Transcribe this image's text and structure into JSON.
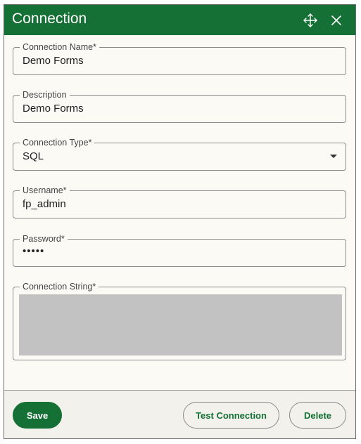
{
  "dialog": {
    "title": "Connection"
  },
  "header_icons": {
    "move": "move-icon",
    "close": "close-icon"
  },
  "fields": {
    "connection_name": {
      "label": "Connection Name*",
      "value": "Demo Forms"
    },
    "description": {
      "label": "Description",
      "value": "Demo Forms"
    },
    "connection_type": {
      "label": "Connection Type*",
      "value": "SQL"
    },
    "username": {
      "label": "Username*",
      "value": "fp_admin"
    },
    "password": {
      "label": "Password*",
      "value": "•••••"
    },
    "connection_string": {
      "label": "Connection String*"
    }
  },
  "buttons": {
    "save": "Save",
    "test_connection": "Test Connection",
    "delete": "Delete"
  },
  "colors": {
    "accent": "#157035",
    "header_text": "#ffffff",
    "redacted_area": "#c2c2c2"
  }
}
